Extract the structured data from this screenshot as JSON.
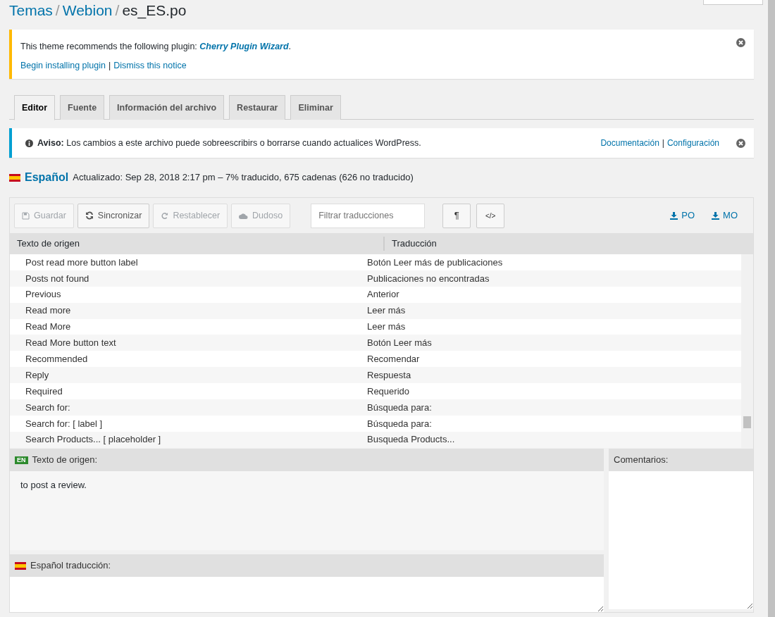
{
  "breadcrumb": [
    {
      "label": "Temas",
      "kind": "link"
    },
    {
      "label": "/",
      "kind": "separator"
    },
    {
      "label": "Webion",
      "kind": "link"
    },
    {
      "label": "/",
      "kind": "separator"
    },
    {
      "label": "es_ES.po",
      "kind": "current"
    }
  ],
  "plugin_notice": {
    "text": "This theme recommends the following plugin:",
    "plugin": "Cherry Plugin Wizard",
    "suffix": ".",
    "links": [
      {
        "label": "Begin installing plugin",
        "kind": "link"
      },
      {
        "label": "|",
        "kind": "separator"
      },
      {
        "label": "Dismiss this notice",
        "kind": "link"
      }
    ]
  },
  "tabs": [
    {
      "label": "Editor",
      "selected": true
    },
    {
      "label": "Fuente",
      "selected": false
    },
    {
      "label": "Información del archivo",
      "selected": false
    },
    {
      "label": "Restaurar",
      "selected": false
    },
    {
      "label": "Eliminar",
      "selected": false
    }
  ],
  "warning": {
    "text": "**Aviso:** Los cambios a este archivo puede sobreescribirs o borrarse cuando actualices WordPress.",
    "links": [
      {
        "label": "Documentación",
        "kind": "link"
      },
      {
        "label": "|",
        "kind": "separator"
      },
      {
        "label": "Configuración",
        "kind": "link"
      }
    ]
  },
  "language": {
    "name": "Español",
    "status": "Actualizado: Sep 28, 2018 2:17 pm – 7% traducido, 675 cadenas (626 no traducido)"
  },
  "toolbar": {
    "buttons": [
      {
        "label": "Guardar",
        "kind": "save",
        "disabled": true
      },
      {
        "label": "Sincronizar",
        "kind": "sync",
        "disabled": false
      },
      {
        "label": "Restablecer",
        "kind": "revert",
        "disabled": true
      },
      {
        "label": "Dudoso",
        "kind": "fuzzy",
        "disabled": true
      }
    ],
    "filter": {
      "placeholder": "Filtrar traducciones"
    },
    "toggles": [
      "¶",
      "</>"
    ],
    "downloads": [
      "PO",
      "MO"
    ]
  },
  "table": {
    "columns": [
      "Texto de origen",
      "Traducción"
    ],
    "rows": [
      [
        "Post read more button label",
        "Botón Leer más de publicaciones"
      ],
      [
        "Posts not found",
        "Publicaciones no encontradas"
      ],
      [
        "Previous",
        "Anterior"
      ],
      [
        "Read more",
        "Leer más"
      ],
      [
        "Read More",
        "Leer más"
      ],
      [
        "Read More button text",
        "Botón Leer más"
      ],
      [
        "Recommended",
        "Recomendar"
      ],
      [
        "Reply",
        "Respuesta"
      ],
      [
        "Required",
        "Requerido"
      ],
      [
        "Search for:",
        "Búsqueda para:"
      ],
      [
        "Search for: [ label ]",
        "Búsqueda para:"
      ],
      [
        "Search Products... [ placeholder ]",
        "Busqueda Products..."
      ]
    ]
  },
  "source_panel": {
    "badge": "EN",
    "title": "Texto de origen:",
    "text": "to post a review."
  },
  "comments_panel": {
    "title": "Comentarios:"
  },
  "translation_panel": {
    "title": "Español traducción:"
  }
}
